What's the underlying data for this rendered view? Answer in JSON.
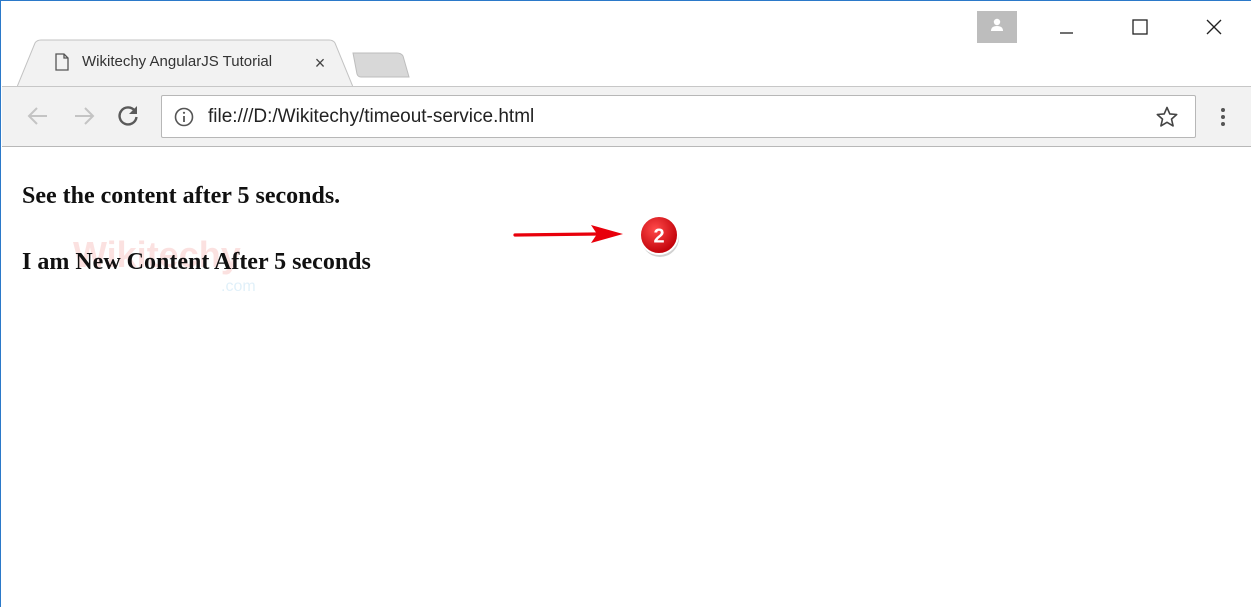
{
  "browser": {
    "tab": {
      "title": "Wikitechy AngularJS Tutorial",
      "close_glyph": "×"
    },
    "address_bar": {
      "url": "file:///D:/Wikitechy/timeout-service.html"
    },
    "icons": {
      "tab": "page-icon",
      "back": "back-arrow-icon",
      "forward": "forward-arrow-icon",
      "reload": "reload-icon",
      "info": "info-icon",
      "bookmark": "star-icon",
      "menu": "kebab-menu-icon",
      "profile": "user-profile-icon"
    }
  },
  "page": {
    "line1": "See the content after 5 seconds.",
    "line2": "I am New Content After 5 seconds"
  },
  "annotation": {
    "step_number": "2",
    "color": "#e8000b"
  },
  "colors": {
    "window_border": "#2b79c9",
    "toolbar_bg": "#f2f2f2"
  }
}
